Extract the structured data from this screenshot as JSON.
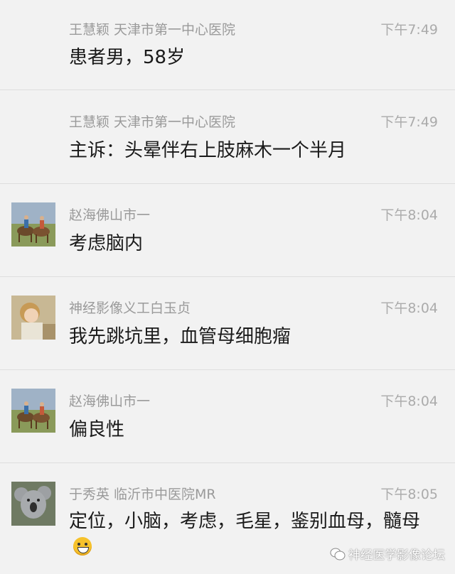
{
  "messages": [
    {
      "sender": "王慧颖 天津市第一中心医院",
      "time": "下午7:49",
      "text": "患者男，58岁",
      "avatar": false
    },
    {
      "sender": "王慧颖 天津市第一中心医院",
      "time": "下午7:49",
      "text": "主诉：头晕伴右上肢麻木一个半月",
      "avatar": false
    },
    {
      "sender": "赵海佛山市一",
      "time": "下午8:04",
      "text": "考虑脑内",
      "avatar": "horse-riders-photo"
    },
    {
      "sender": "神经影像义工白玉贞",
      "time": "下午8:04",
      "text": "我先跳坑里，血管母细胞瘤",
      "avatar": "child-portrait-photo"
    },
    {
      "sender": "赵海佛山市一",
      "time": "下午8:04",
      "text": "偏良性",
      "avatar": "horse-riders-photo"
    },
    {
      "sender": "于秀英 临沂市中医院MR",
      "time": "下午8:05",
      "text": "定位，小脑，考虑，毛星，鉴别血母，髓母",
      "avatar": "koala-photo",
      "emoji": "grinning-face"
    }
  ],
  "watermark": "神经医学影像论坛",
  "colors": {
    "background": "#f2f2f2",
    "sender": "#9a9a9a",
    "text": "#1a1a1a",
    "divider": "#dedede"
  }
}
